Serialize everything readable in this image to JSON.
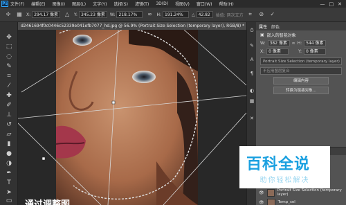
{
  "app": {
    "logo": "Ps"
  },
  "menu": [
    "文件(F)",
    "编辑(E)",
    "图像(I)",
    "图层(L)",
    "文字(Y)",
    "选择(S)",
    "滤镜(T)",
    "3D(D)",
    "视图(V)",
    "窗口(W)",
    "帮助(H)"
  ],
  "window_controls": [
    "—",
    "□",
    "✕"
  ],
  "options": {
    "x_label": "X:",
    "x_value": "294.17 像素",
    "y_label": "Y:",
    "y_value": "345.23 像素",
    "w_label": "W:",
    "w_value": "218.17%",
    "h_label": "H:",
    "h_value": "191.24%",
    "angle_label": "△",
    "angle_value": "42.82",
    "interp_label": "插值:",
    "interp_value": "两次立方"
  },
  "document_tab": {
    "title": "d2461694f0c0446c52339e041efb7077_hd.jpg @ 56.9% (Portrait Size Selection (temporary layer), RGB/8) *",
    "close": "×"
  },
  "properties": {
    "tabs": [
      "属性",
      "颜色"
    ],
    "subtitle": "嵌入的智能对象",
    "w_label": "W:",
    "w_value": "382 像素",
    "h_label": "H:",
    "h_value": "544 像素",
    "x_label": "X:",
    "x_value": "0 像素",
    "y_label": "Y:",
    "y_value": "0 像素",
    "layer_name": "Portrait Size Selection (temporary layer)",
    "layer_comp": "不应用图层复合",
    "btn_edit": "编辑内容",
    "btn_convert": "转换为链接对象..."
  },
  "layers": {
    "tabs": [
      "图层",
      "通道",
      "路径"
    ],
    "rows": [
      "Portrait Size Selection (temporary layer)",
      "Temp_sel"
    ]
  },
  "watermark": {
    "title": "百科全说",
    "subtitle": "助你轻松解决"
  },
  "caption": "通过调整图"
}
